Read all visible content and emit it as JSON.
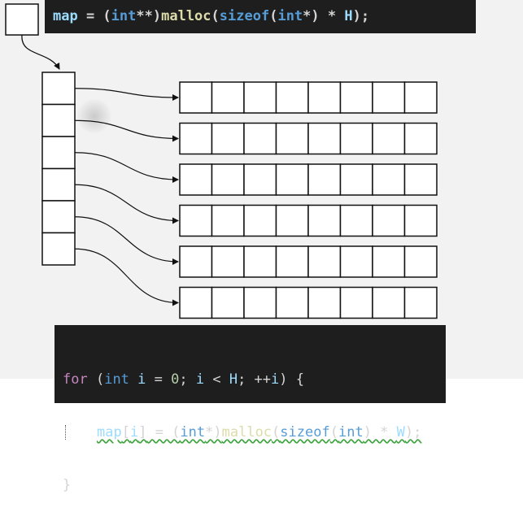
{
  "top_code": {
    "t1": "map",
    "t2": " = (",
    "t3": "int",
    "t4": "**)",
    "t5": "malloc",
    "t6": "(",
    "t7": "sizeof",
    "t8": "(",
    "t9": "int",
    "t10": "*) * ",
    "t11": "H",
    "t12": ");"
  },
  "bottom_code": {
    "line1": {
      "for": "for",
      "p1": " (",
      "int": "int",
      "i1": " i",
      "eq": " = ",
      "zero": "0",
      "semi1": "; ",
      "i2": "i",
      "lt": " < ",
      "H": "H",
      "semi2": "; ++",
      "i3": "i",
      "close": ") {"
    },
    "line2": {
      "map": "map",
      "idx_open": "[",
      "i": "i",
      "idx_close": "]",
      "eq": " = (",
      "int": "int",
      "cast": "*)",
      "malloc": "malloc",
      "p1": "(",
      "sizeof": "sizeof",
      "p2": "(",
      "int2": "int",
      "mul": ") * ",
      "W": "W",
      "end": ");"
    },
    "line3": {
      "brace": "}"
    }
  },
  "diagram": {
    "pointer_cells": 1,
    "array_cells": 6,
    "row_count": 6,
    "row_cells": 8,
    "colors": {
      "stroke": "#111111",
      "cell_fill": "#ffffff"
    }
  }
}
